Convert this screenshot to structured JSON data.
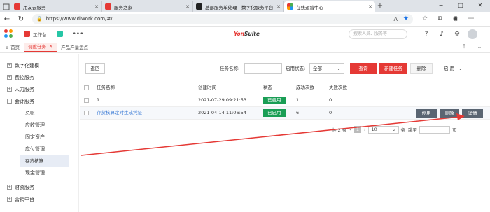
{
  "browser": {
    "tabs": [
      {
        "title": "用友云服务",
        "icon_color": "#e53935",
        "active": false
      },
      {
        "title": "服务之家",
        "icon_color": "#e53935",
        "active": false
      },
      {
        "title": "总部服务单处理 - 数字化服务平台",
        "icon_color": "#222222",
        "active": false
      },
      {
        "title": "在线运营中心",
        "icon_color": "#4caf50",
        "active": true
      }
    ],
    "new_tab": "+",
    "url": "https://www.diwork.com/#/",
    "window_controls": [
      "−",
      "□",
      "✕"
    ]
  },
  "app_header": {
    "workbench_label": "工作台",
    "brand_prefix": "Yon",
    "brand_suffix": "Suite",
    "search_placeholder": "搜索人员、服务等"
  },
  "page_tabs": {
    "home": "首页",
    "active": "调度任务",
    "other": "产品产量盘点"
  },
  "sidebar": {
    "items": [
      {
        "label": "数字化建模",
        "toggle": "+"
      },
      {
        "label": "费控服务",
        "toggle": "+"
      },
      {
        "label": "人力服务",
        "toggle": "+"
      },
      {
        "label": "会计服务",
        "toggle": "−"
      }
    ],
    "sub_items": [
      "总账",
      "应收管理",
      "固定资产",
      "应付管理",
      "存货核算",
      "现金管理"
    ],
    "selected_sub": "存货核算",
    "bottom_items": [
      {
        "label": "财资服务",
        "toggle": "+"
      },
      {
        "label": "营销中台",
        "toggle": "+"
      }
    ]
  },
  "toolbar": {
    "back": "返回",
    "task_name_label": "任务名称:",
    "task_name_value": "",
    "status_label": "启用状态:",
    "status_value": "全部",
    "query": "查询",
    "new_task": "新建任务",
    "delete": "删除",
    "enable": "启 用"
  },
  "table": {
    "headers": [
      "任务名称",
      "创建时间",
      "状态",
      "成功次数",
      "失败次数"
    ],
    "rows": [
      {
        "name": "1",
        "created": "2021-07-29 09:21:53",
        "status": "已启用",
        "success": "1",
        "fail": "0"
      },
      {
        "name": "存货核算定时生成凭证",
        "created": "2021-04-14 11:06:54",
        "status": "已启用",
        "success": "6",
        "fail": "0"
      }
    ],
    "row_actions": [
      "停用",
      "删除",
      "详情"
    ]
  },
  "pager": {
    "total": "共 2 条",
    "current_page": "1",
    "page_size": "10",
    "per_page_unit": "条",
    "jump_label": "跳至",
    "page_unit": "页"
  },
  "colors": {
    "accent_red": "#e53935",
    "status_green": "#1a9e55",
    "annotation_arrow": "#e53935"
  }
}
